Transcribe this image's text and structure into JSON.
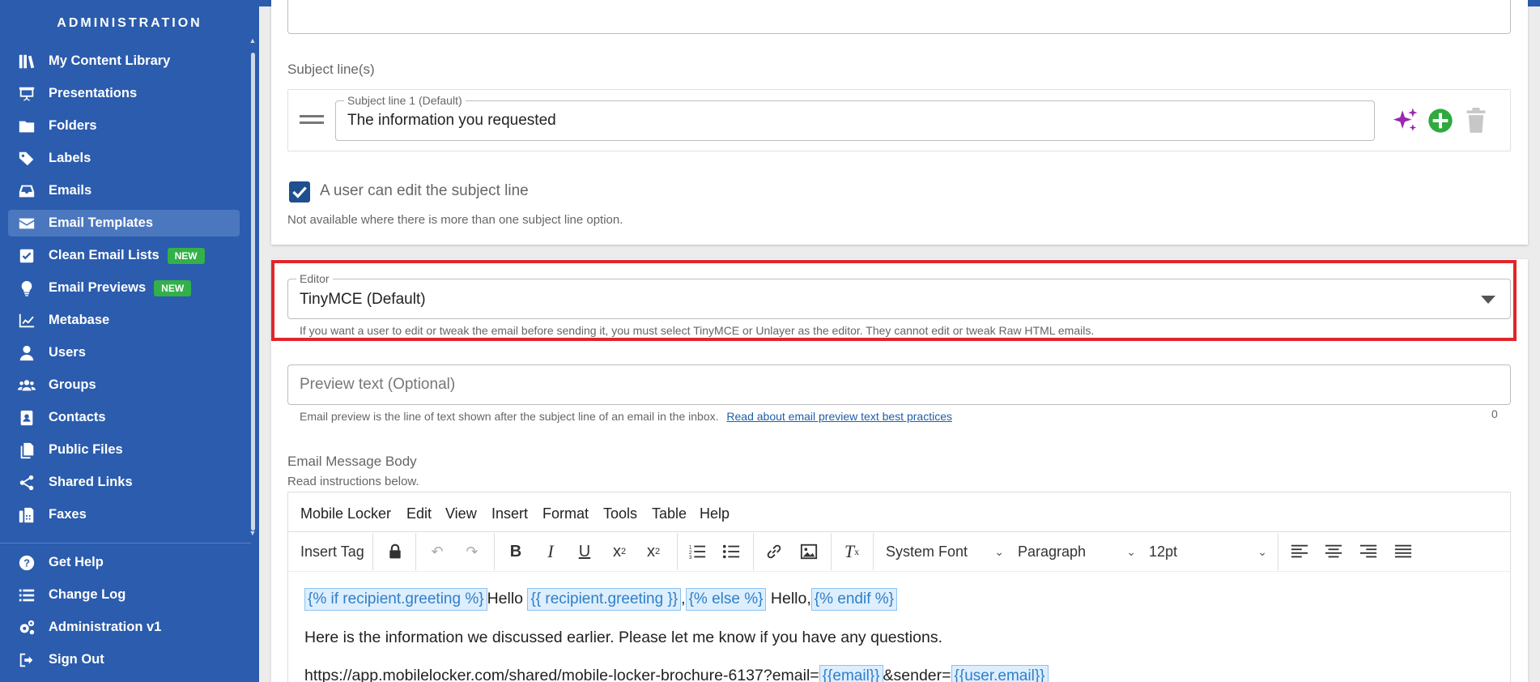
{
  "sidebar": {
    "title": "ADMINISTRATION",
    "items": [
      {
        "label": "My Content Library",
        "icon": "books-icon"
      },
      {
        "label": "Presentations",
        "icon": "presentation-icon"
      },
      {
        "label": "Folders",
        "icon": "folder-icon"
      },
      {
        "label": "Labels",
        "icon": "tags-icon"
      },
      {
        "label": "Emails",
        "icon": "inbox-icon"
      },
      {
        "label": "Email Templates",
        "icon": "envelope-icon",
        "active": true
      },
      {
        "label": "Clean Email Lists",
        "icon": "checkbox-icon",
        "badge": "NEW"
      },
      {
        "label": "Email Previews",
        "icon": "lightbulb-icon",
        "badge": "NEW"
      },
      {
        "label": "Metabase",
        "icon": "chart-line-icon"
      },
      {
        "label": "Users",
        "icon": "user-icon"
      },
      {
        "label": "Groups",
        "icon": "users-icon"
      },
      {
        "label": "Contacts",
        "icon": "address-book-icon"
      },
      {
        "label": "Public Files",
        "icon": "files-icon"
      },
      {
        "label": "Shared Links",
        "icon": "share-icon"
      },
      {
        "label": "Faxes",
        "icon": "fax-icon"
      }
    ],
    "bottom_items": [
      {
        "label": "Get Help",
        "icon": "help-icon"
      },
      {
        "label": "Change Log",
        "icon": "list-icon"
      },
      {
        "label": "Administration v1",
        "icon": "gears-icon"
      },
      {
        "label": "Sign Out",
        "icon": "sign-out-icon"
      }
    ]
  },
  "subject": {
    "section_label": "Subject line(s)",
    "field_label": "Subject line 1 (Default)",
    "field_value": "The information you requested",
    "checkbox_label": "A user can edit the subject line",
    "checkbox_checked": true,
    "note": "Not available where there is more than one subject line option."
  },
  "editor": {
    "label": "Editor",
    "value": "TinyMCE (Default)",
    "help": "If you want a user to edit or tweak the email before sending it, you must select TinyMCE or Unlayer as the editor. They cannot edit or tweak Raw HTML emails."
  },
  "preview": {
    "placeholder": "Preview text (Optional)",
    "help": "Email preview is the line of text shown after the subject line of an email in the inbox.",
    "link": "Read about email preview text best practices",
    "count": "0"
  },
  "body": {
    "label": "Email Message Body",
    "sublabel": "Read instructions below.",
    "menu": [
      "Mobile Locker",
      "Edit",
      "View",
      "Insert",
      "Format",
      "Tools",
      "Table",
      "Help"
    ],
    "toolbar": {
      "insert_tag": "Insert Tag",
      "font": "System Font",
      "block": "Paragraph",
      "size": "12pt"
    },
    "content": {
      "tag_if": "{% if recipient.greeting %}",
      "hello": "Hello",
      "tag_greeting": "{{ recipient.greeting }}",
      "comma": ",",
      "tag_else": "{% else %}",
      "hello_comma": "Hello,",
      "tag_endif": "{% endif %}",
      "line2": "Here is the information we discussed earlier. Please let me know if you have any questions.",
      "url_prefix": "https://app.mobilelocker.com/shared/mobile-locker-brochure-6137?email=",
      "tag_email": "{{email}}",
      "url_mid": "&sender=",
      "tag_user_email": "{{user.email}}"
    }
  },
  "colors": {
    "sidebar_bg": "#2b5cad",
    "active_item_bg": "#4b77bf",
    "badge_green": "#33b04a",
    "highlight_red": "#e0262b",
    "sparkle_purple": "#9b27b0",
    "add_green": "#2eaa3f",
    "checkbox_blue": "#1f4f8f"
  }
}
